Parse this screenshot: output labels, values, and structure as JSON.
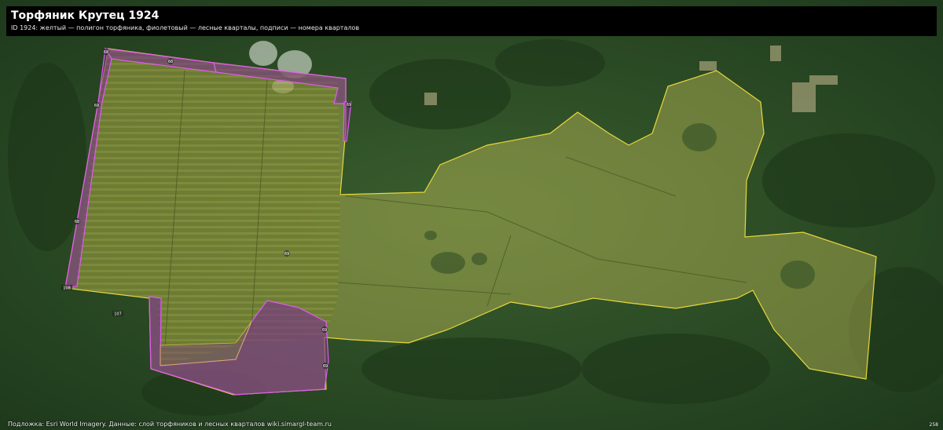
{
  "header": {
    "title": "Торфяник Крутец 1924",
    "subtitle": "ID 1924: желтый — полигон торфяника, фиолетовый — лесные кварталы, подписи — номера кварталов"
  },
  "map": {
    "colors": {
      "peat_fill": "#c9c35a",
      "peat_outline": "#e8d83a",
      "forest_quarter_fill": "#7a2f8f",
      "forest_quarter_outline": "#e15cf0",
      "forest_background": "#2a4a24",
      "title_background": "#000000"
    },
    "layers": [
      {
        "name": "полигон торфяника",
        "color": "желтый"
      },
      {
        "name": "лесные кварталы",
        "color": "фиолетовый"
      }
    ],
    "quarter_labels": [
      "68",
      "68",
      "69",
      "69",
      "68",
      "108",
      "69",
      "107",
      "69",
      "69"
    ]
  },
  "footer": {
    "attribution": "Подложка: Esri World Imagery. Данные: слой торфяников и лесных кварталов wiki.simargl-team.ru",
    "corner_label": "258"
  }
}
